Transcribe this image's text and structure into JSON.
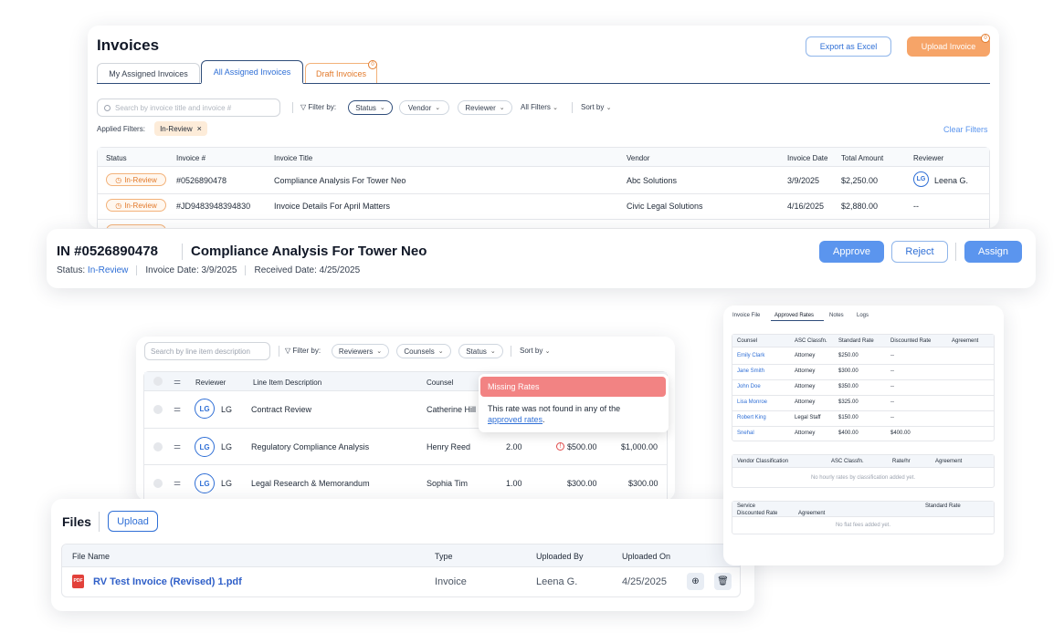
{
  "invoices": {
    "title": "Invoices",
    "export_label": "Export as Excel",
    "upload_label": "Upload Invoice",
    "upload_badge": "0",
    "tabs": [
      {
        "label": "My Assigned Invoices"
      },
      {
        "label": "All Assigned Invoices"
      },
      {
        "label": "Draft Invoices",
        "badge": "0"
      }
    ],
    "search_placeholder": "Search by invoice title and invoice #",
    "filter_by": "Filter by:",
    "filters": [
      "Status",
      "Vendor",
      "Reviewer",
      "All Filters"
    ],
    "sort_by": "Sort by",
    "applied_filters_label": "Applied Filters:",
    "applied_chip": "In-Review",
    "clear_filters": "Clear Filters",
    "columns": [
      "Status",
      "Invoice #",
      "Invoice Title",
      "Vendor",
      "Invoice Date",
      "Total Amount",
      "Reviewer"
    ],
    "rows": [
      {
        "status": "In-Review",
        "number": "#0526890478",
        "title": "Compliance Analysis For Tower Neo",
        "vendor": "Abc Solutions",
        "date": "3/9/2025",
        "amount": "$2,250.00",
        "reviewer_initials": "LG",
        "reviewer": "Leena G."
      },
      {
        "status": "In-Review",
        "number": "#JD9483948394830",
        "title": "Invoice Details For April Matters",
        "vendor": "Civic Legal Solutions",
        "date": "4/16/2025",
        "amount": "$2,880.00",
        "reviewer": "--"
      }
    ]
  },
  "detail": {
    "invoice_no": "IN #0526890478",
    "title": "Compliance Analysis For Tower Neo",
    "status_label": "Status:",
    "status_value": "In-Review",
    "invoice_date_label": "Invoice Date:",
    "invoice_date": "3/9/2025",
    "received_label": "Received Date:",
    "received_date": "4/25/2025",
    "approve": "Approve",
    "reject": "Reject",
    "assign": "Assign"
  },
  "lines": {
    "search_placeholder": "Search by line item description",
    "filter_by": "Filter by:",
    "filters": [
      "Reviewers",
      "Counsels",
      "Status"
    ],
    "sort_by": "Sort by",
    "columns": [
      "Reviewer",
      "Line Item Description",
      "Counsel"
    ],
    "rows": [
      {
        "reviewer_initials": "LG",
        "reviewer": "LG",
        "description": "Contract Review",
        "counsel": "Catherine Hill",
        "qty": "",
        "rate": "",
        "total": ""
      },
      {
        "reviewer_initials": "LG",
        "reviewer": "LG",
        "description": "Regulatory Compliance Analysis",
        "counsel": "Henry Reed",
        "qty": "2.00",
        "rate": "$500.00",
        "total": "$1,000.00"
      },
      {
        "reviewer_initials": "LG",
        "reviewer": "LG",
        "description": "Legal Research & Memorandum",
        "counsel": "Sophia Tim",
        "qty": "1.00",
        "rate": "$300.00",
        "total": "$300.00"
      }
    ],
    "tooltip_title": "Missing Rates",
    "tooltip_text": "This rate was not found in any of the",
    "tooltip_link": "approved rates",
    "tooltip_end": "."
  },
  "files": {
    "title": "Files",
    "upload": "Upload",
    "columns": [
      "File Name",
      "Type",
      "Uploaded By",
      "Uploaded On"
    ],
    "rows": [
      {
        "icon_text": "PDF",
        "name": "RV Test Invoice (Revised) 1.pdf",
        "type": "Invoice",
        "by": "Leena G.",
        "on": "4/25/2025"
      }
    ]
  },
  "rates": {
    "tabs": [
      "Invoice File",
      "Approved Rates",
      "Notes",
      "Logs"
    ],
    "counsel_columns": [
      "Counsel",
      "ASC Classfn.",
      "Standard Rate",
      "Discounted Rate",
      "Agreement"
    ],
    "counsel_rows": [
      {
        "name": "Emily Clark",
        "class": "Attorney",
        "std": "$250.00",
        "disc": "--"
      },
      {
        "name": "Jane Smith",
        "class": "Attorney",
        "std": "$300.00",
        "disc": "--"
      },
      {
        "name": "John Doe",
        "class": "Attorney",
        "std": "$350.00",
        "disc": "--"
      },
      {
        "name": "Lisa Monroe",
        "class": "Attorney",
        "std": "$325.00",
        "disc": "--"
      },
      {
        "name": "Robert King",
        "class": "Legal Staff",
        "std": "$150.00",
        "disc": "--"
      },
      {
        "name": "Snehal",
        "class": "Attorney",
        "std": "$400.00",
        "disc": "$400.00"
      }
    ],
    "vendor_columns": [
      "Vendor Classification",
      "ASC Classfn.",
      "Rate/hr",
      "Agreement"
    ],
    "vendor_empty": "No hourly rates by classification added yet.",
    "service_columns": [
      "Service",
      "Standard Rate",
      "Discounted Rate",
      "Agreement"
    ],
    "service_empty": "No flat fees added yet."
  },
  "colors": {
    "accent": "#2f6fd6",
    "primary_btn": "#5b95ee",
    "upload_btn": "#f6a468",
    "alert": "#f28383",
    "status": "#e27a2b"
  }
}
